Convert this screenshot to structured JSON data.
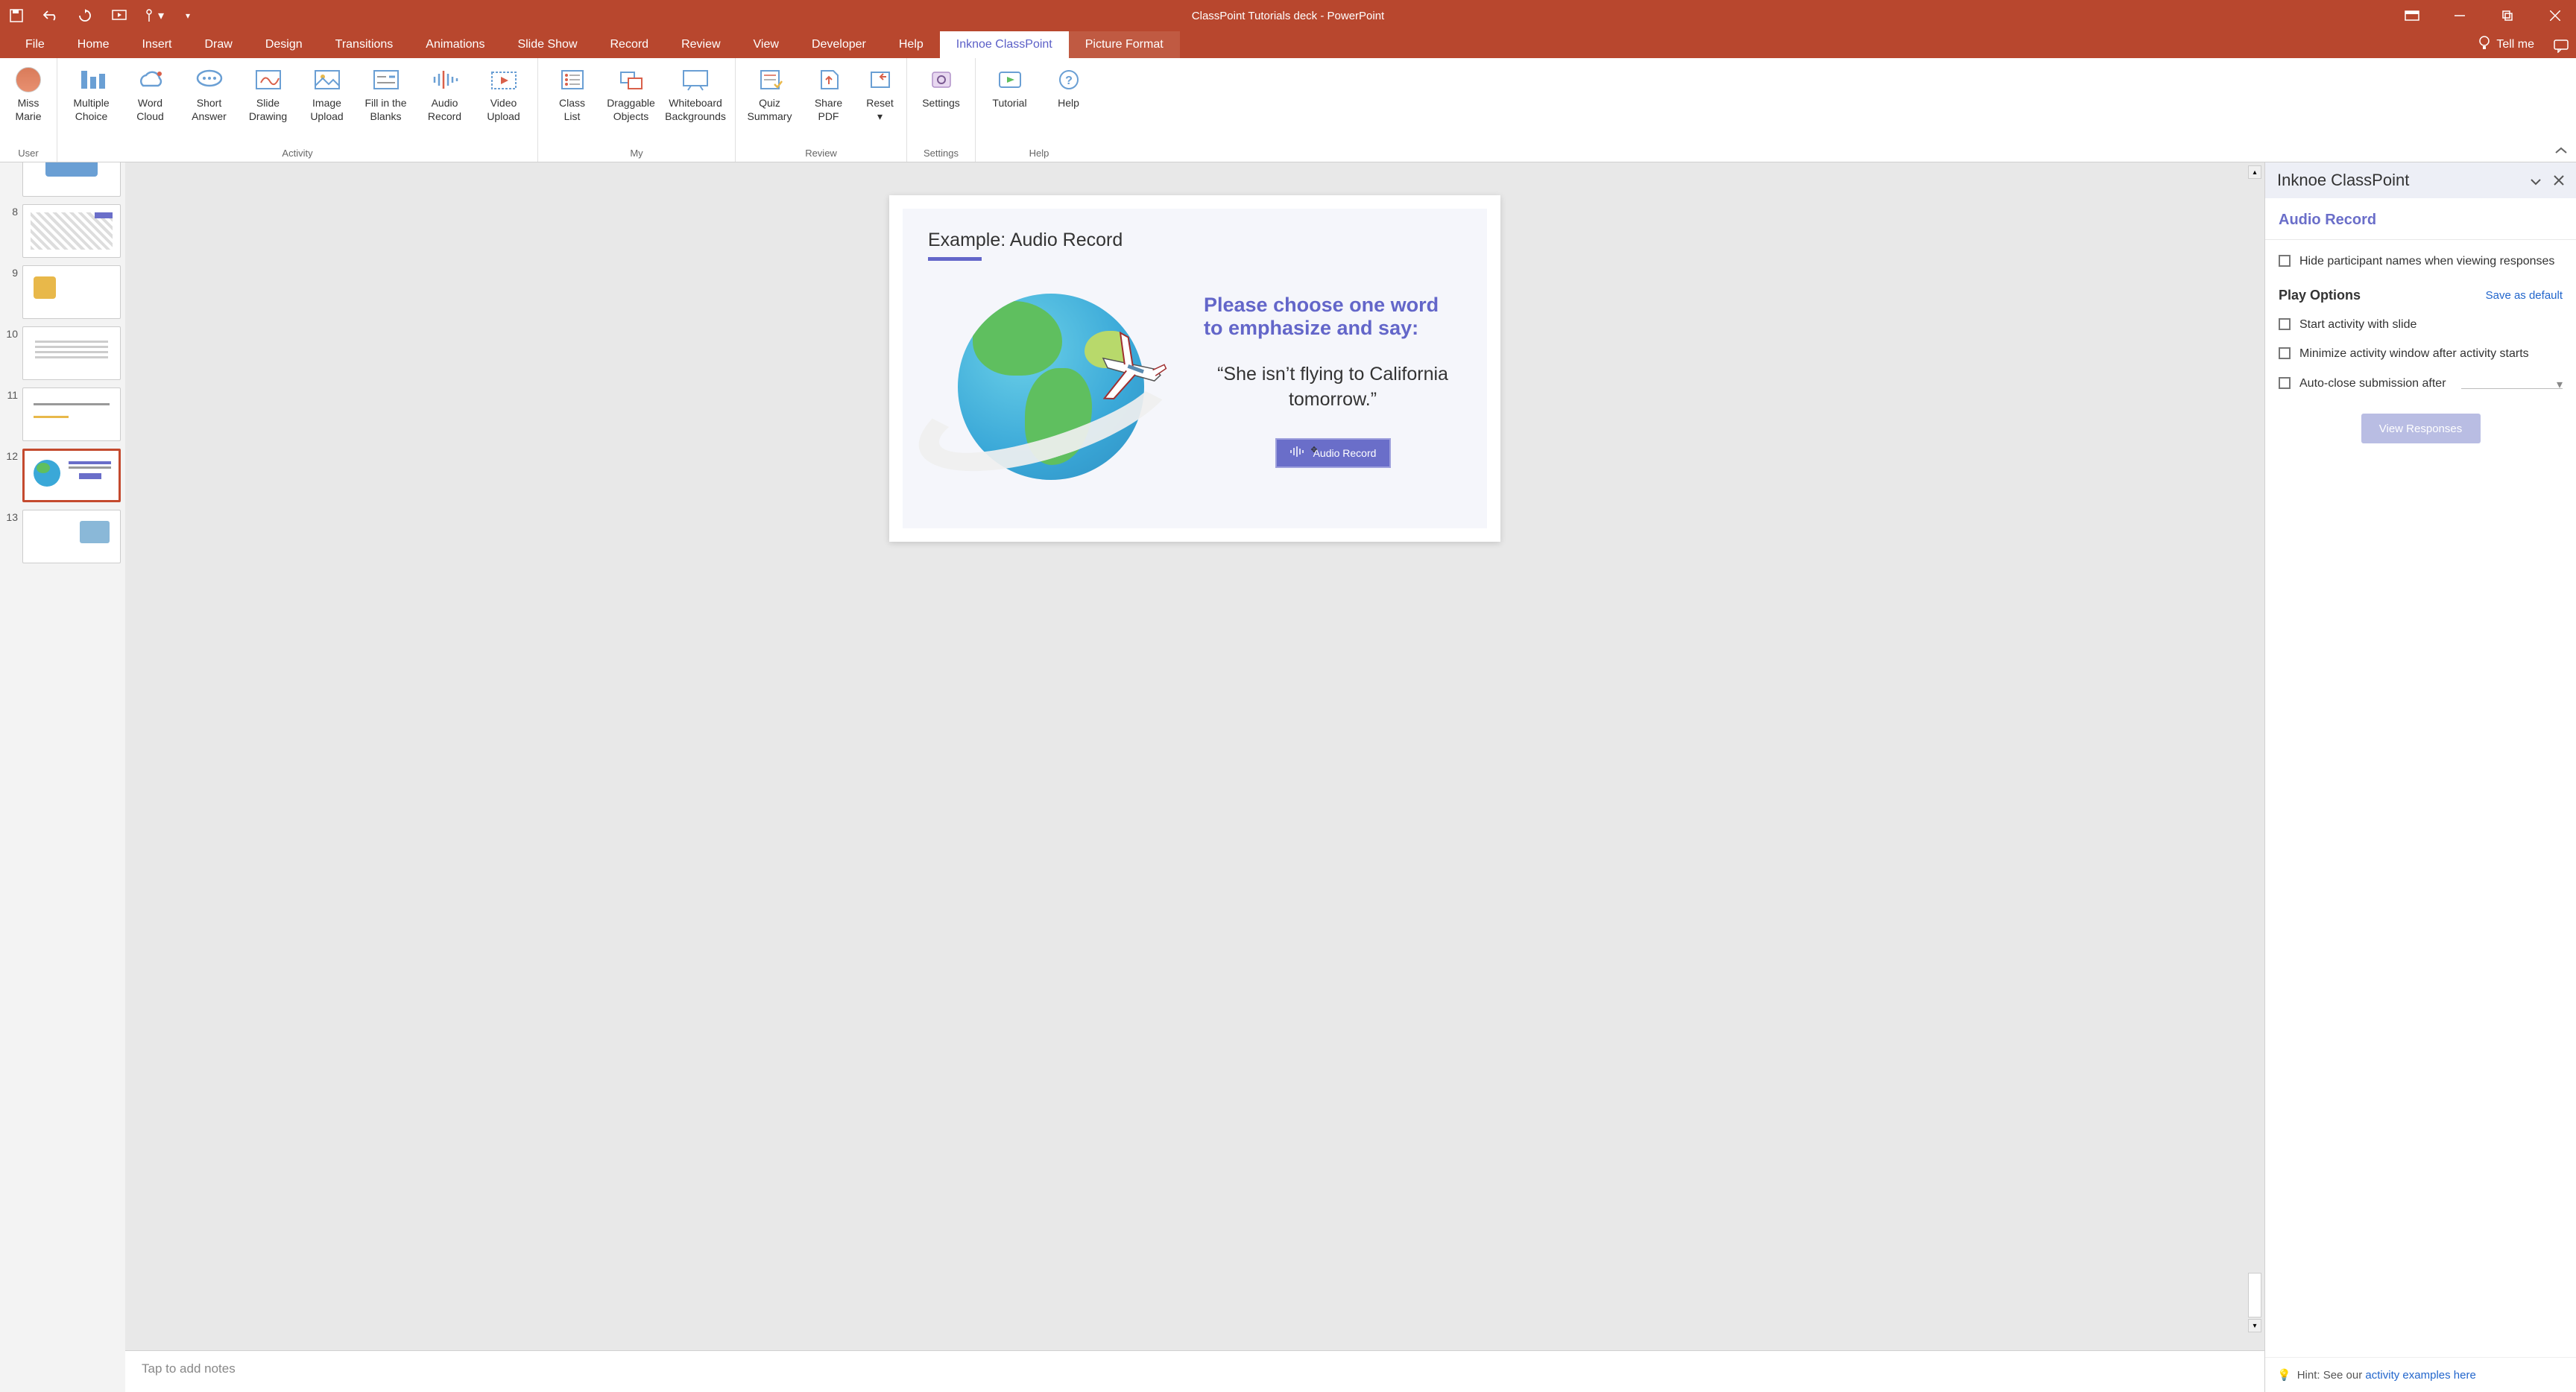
{
  "title": "ClassPoint Tutorials deck - PowerPoint",
  "tabs": {
    "file": "File",
    "home": "Home",
    "insert": "Insert",
    "draw": "Draw",
    "design": "Design",
    "transitions": "Transitions",
    "animations": "Animations",
    "slideshow": "Slide Show",
    "record": "Record",
    "review": "Review",
    "view": "View",
    "developer": "Developer",
    "help": "Help",
    "classpoint": "Inknoe ClassPoint",
    "picformat": "Picture Format",
    "tellme": "Tell me"
  },
  "user": {
    "name": "Miss\nMarie",
    "group": "User"
  },
  "ribbon": {
    "activity": {
      "label": "Activity",
      "items": {
        "mc": "Multiple\nChoice",
        "wc": "Word\nCloud",
        "sa": "Short\nAnswer",
        "sd": "Slide\nDrawing",
        "iu": "Image\nUpload",
        "fib": "Fill in the\nBlanks",
        "ar": "Audio\nRecord",
        "vu": "Video\nUpload"
      }
    },
    "my": {
      "label": "My",
      "items": {
        "cl": "Class\nList",
        "do": "Draggable\nObjects",
        "wb": "Whiteboard\nBackgrounds"
      }
    },
    "review": {
      "label": "Review",
      "items": {
        "qs": "Quiz\nSummary",
        "sp": "Share\nPDF",
        "rs": "Reset"
      }
    },
    "settings": {
      "label": "Settings",
      "items": {
        "st": "Settings"
      }
    },
    "helpg": {
      "label": "Help",
      "items": {
        "tut": "Tutorial",
        "hlp": "Help"
      }
    }
  },
  "thumbs": [
    {
      "num": "8"
    },
    {
      "num": "9"
    },
    {
      "num": "10"
    },
    {
      "num": "11"
    },
    {
      "num": "12",
      "active": true
    },
    {
      "num": "13"
    }
  ],
  "slide": {
    "title": "Example: Audio Record",
    "heading": "Please choose one word to emphasize and say:",
    "quote": "“She isn’t flying to California tomorrow.”",
    "btn": "Audio Record"
  },
  "notes": {
    "placeholder": "Tap to add notes"
  },
  "panel": {
    "title": "Inknoe ClassPoint",
    "subtitle": "Audio Record",
    "opt_hide": "Hide participant names when viewing responses",
    "play_label": "Play Options",
    "save_default": "Save as default",
    "opt_start": "Start activity with slide",
    "opt_min": "Minimize activity window after activity starts",
    "opt_auto": "Auto-close submission after",
    "view_btn": "View Responses",
    "hint_prefix": "Hint: See our ",
    "hint_link": "activity examples here"
  }
}
